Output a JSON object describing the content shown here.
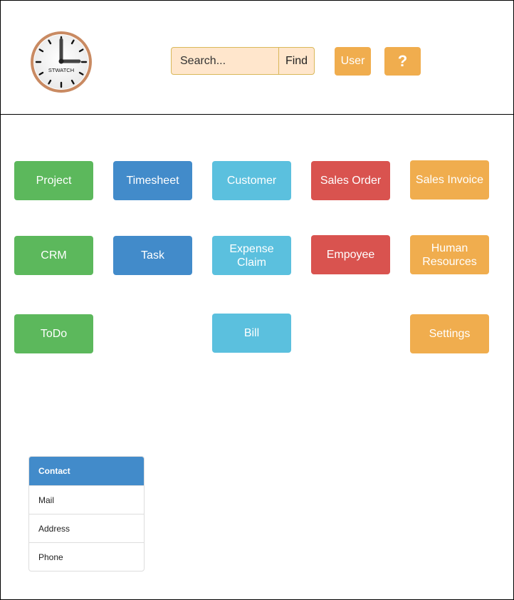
{
  "header": {
    "logo_text": "STWATCH",
    "search": {
      "placeholder": "Search...",
      "value": ""
    },
    "find_label": "Find",
    "user_label": "User",
    "help_label": "?"
  },
  "tiles": {
    "project": "Project",
    "timesheet": "Timesheet",
    "customer": "Customer",
    "sales_order": "Sales Order",
    "sales_invoice": "Sales Invoice",
    "crm": "CRM",
    "task": "Task",
    "expense_claim": "Expense Claim",
    "empoyee": "Empoyee",
    "human_resources": "Human Resources",
    "todo": "ToDo",
    "bill": "Bill",
    "settings": "Settings"
  },
  "contact": {
    "title": "Contact",
    "items": [
      "Mail",
      "Address",
      "Phone"
    ]
  },
  "colors": {
    "green": "#5cb85c",
    "blue": "#428bca",
    "cyan": "#5bc0de",
    "red": "#d9534f",
    "orange": "#f0ad4e",
    "search_bg": "#ffe6cc"
  }
}
